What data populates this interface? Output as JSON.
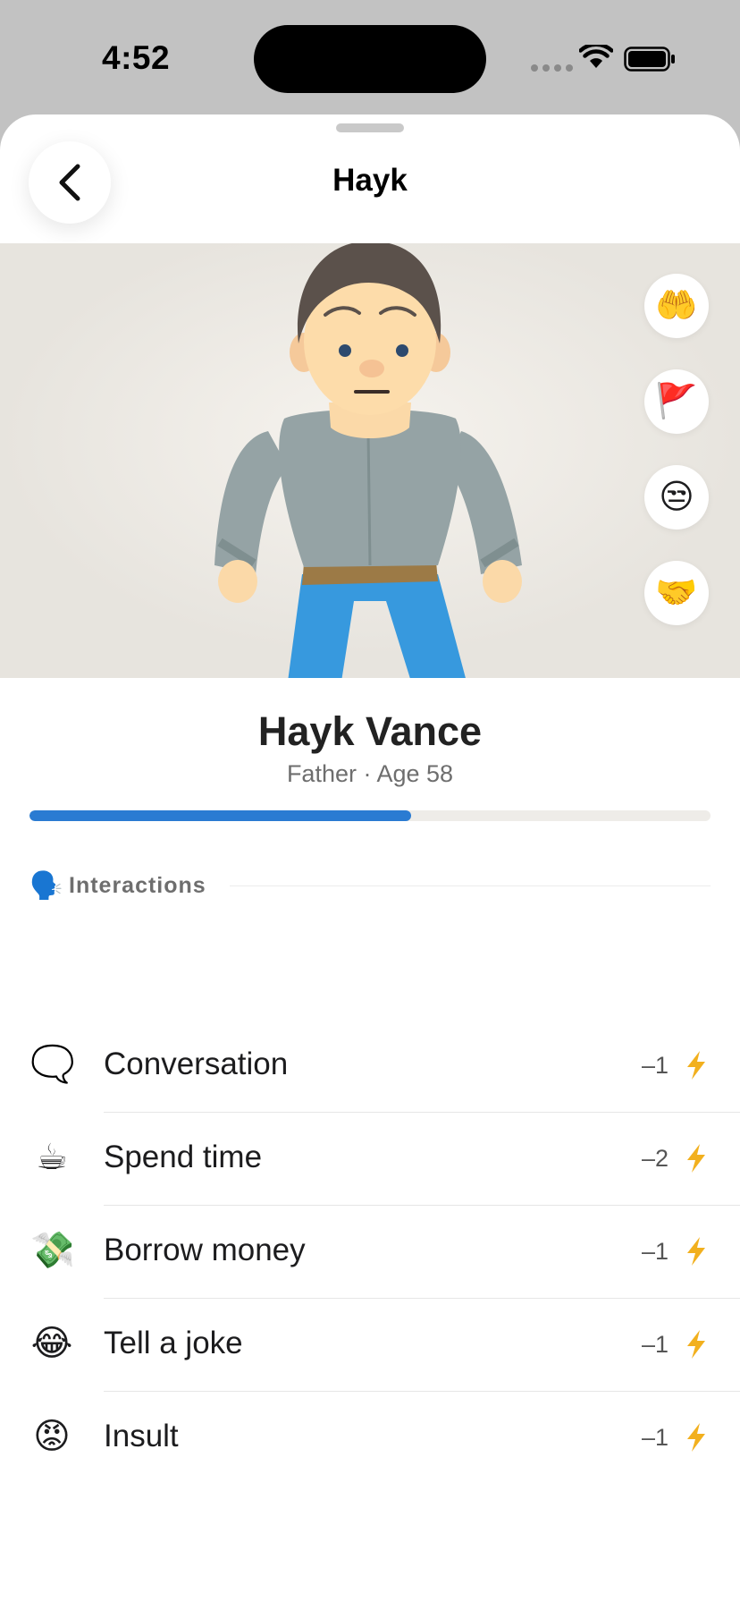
{
  "status_bar": {
    "time": "4:52"
  },
  "header": {
    "title": "Hayk"
  },
  "hero": {
    "actions": [
      {
        "emoji": "🤲",
        "icon": "open-hands-icon"
      },
      {
        "emoji": "🚩",
        "icon": "red-flag-icon"
      },
      {
        "emoji": "😒",
        "icon": "unamused-face-icon"
      },
      {
        "emoji": "🤝",
        "icon": "handshake-icon"
      }
    ]
  },
  "profile": {
    "name": "Hayk Vance",
    "subtitle": "Father · Age 58",
    "relationship_progress_percent": 56
  },
  "interactions": {
    "section_emoji": "🗣️",
    "section_label": "Interactions",
    "items": [
      {
        "emoji": "🗨️",
        "label": "Conversation",
        "cost": "–1"
      },
      {
        "emoji": "☕",
        "label": "Spend time",
        "cost": "–2"
      },
      {
        "emoji": "💸",
        "label": "Borrow money",
        "cost": "–1"
      },
      {
        "emoji": "😂",
        "label": "Tell a joke",
        "cost": "–1"
      },
      {
        "emoji": "😡",
        "label": "Insult",
        "cost": "–1"
      }
    ]
  },
  "colors": {
    "accent_blue": "#2a7bd2",
    "bolt_yellow": "#f2b01e",
    "hero_background": "#e7e4de"
  }
}
